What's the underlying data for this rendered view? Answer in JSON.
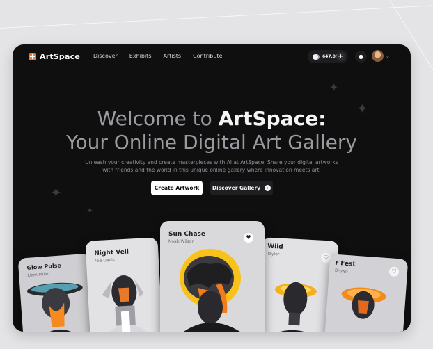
{
  "app": {
    "name": "ArtSpace"
  },
  "nav": {
    "items": [
      "Discover",
      "Exhibits",
      "Artists",
      "Contribute"
    ]
  },
  "account": {
    "points": "647.00"
  },
  "hero": {
    "title_lead": "Welcome to ",
    "title_brand": "ArtSpace:",
    "title_line2": "Your Online Digital Art Gallery",
    "subtitle": "Unleash your creativity and create masterpieces with AI at ArtSpace. Share your digital artworks with friends and the world in this unique online gallery where innovation meets art."
  },
  "cta": {
    "primary": "Create Artwork",
    "secondary": "Discover Gallery"
  },
  "cards": [
    {
      "title": "Glow Pulse",
      "artist": "Liam Miller"
    },
    {
      "title": "Night Veil",
      "artist": "Mia Davis"
    },
    {
      "title": "Sun Chase",
      "artist": "Noah Wilson"
    },
    {
      "title": "Wild",
      "artist": "Taylor"
    },
    {
      "title": "r Fest",
      "artist": "Brown"
    }
  ],
  "colors": {
    "accent": "#f07a2a",
    "frame": "#0f0f10",
    "background": "#e4e4e7"
  },
  "icons": {
    "logo": "plus-square-icon",
    "coin": "coin-icon",
    "add": "plus-icon",
    "notifications": "bell-icon",
    "like": "heart-icon",
    "go": "arrow-right-icon"
  }
}
